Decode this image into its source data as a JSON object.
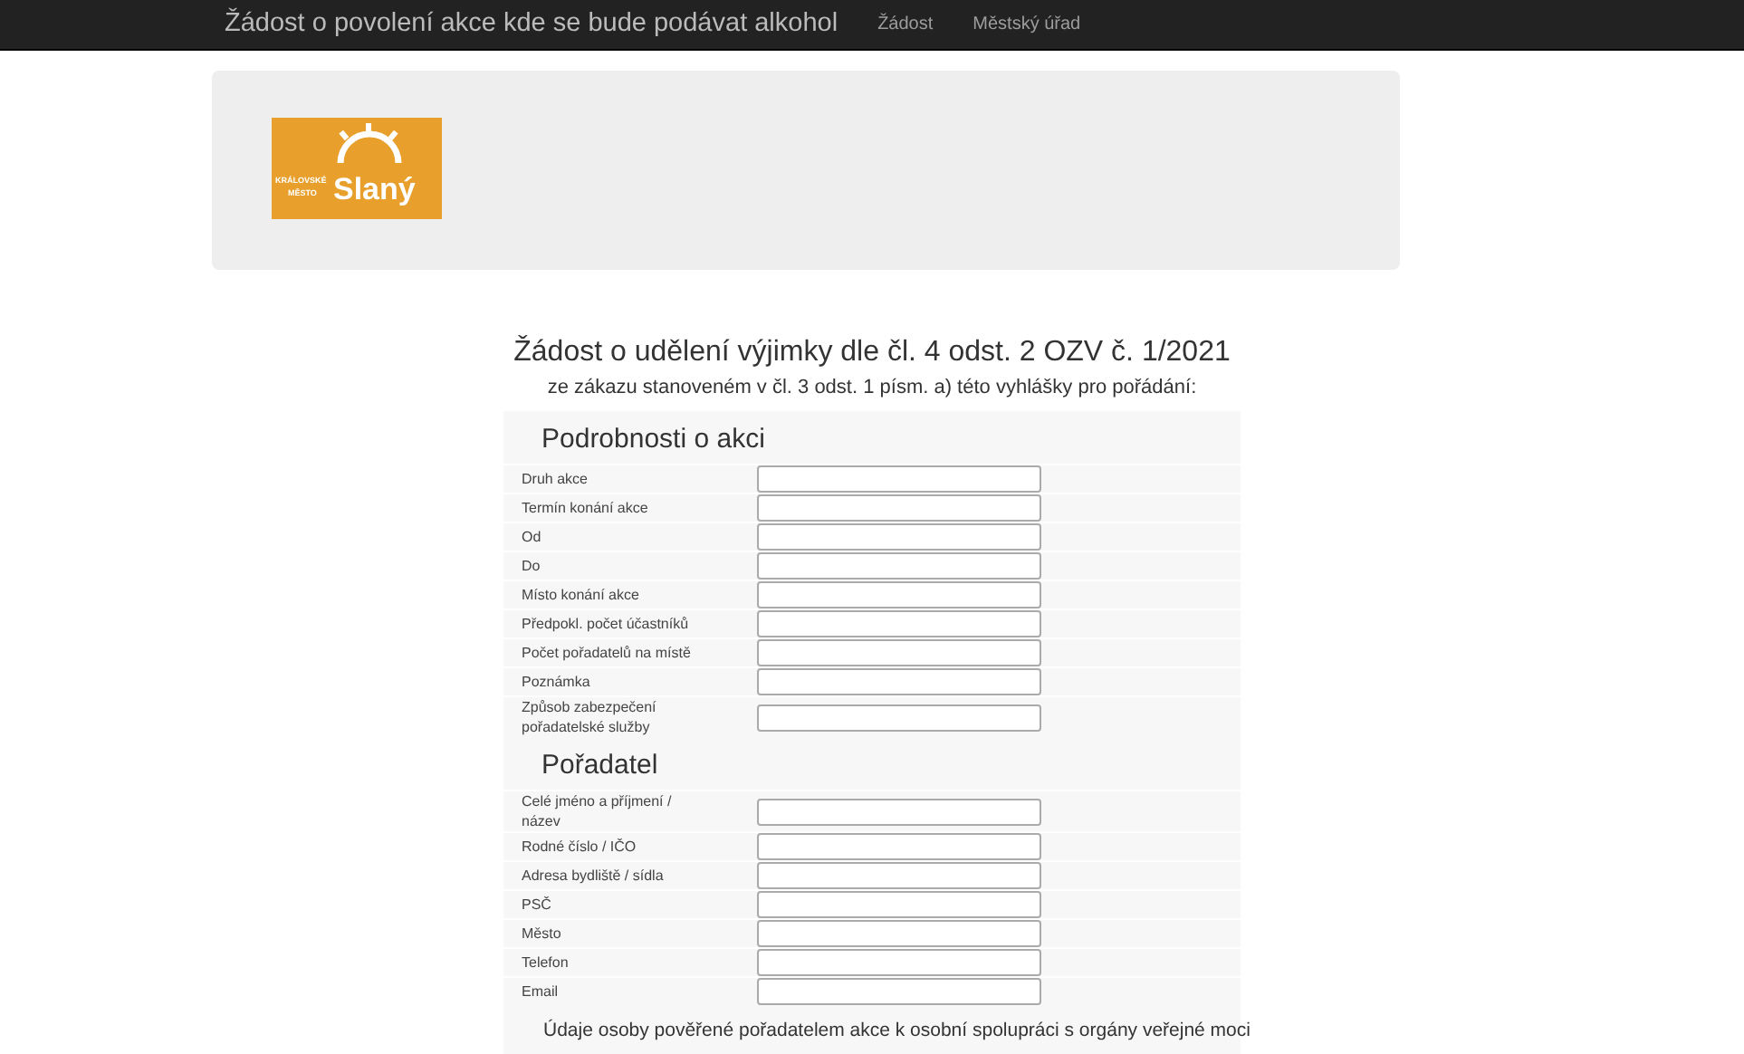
{
  "navbar": {
    "brand": "Žádost o povolení akce kde se bude podávat alkohol",
    "links": [
      "Žádost",
      "Městský úřad"
    ]
  },
  "logo": {
    "line_1": "KRÁLOVSKÉ",
    "line_2": "MĚSTO",
    "name": "Slaný"
  },
  "title": "Žádost o udělení výjimky dle čl. 4 odst. 2 OZV č. 1/2021",
  "subtitle": "ze zákazu stanoveném v čl. 3 odst. 1 písm. a) této vyhlášky pro pořádání:",
  "sections": [
    {
      "heading": "Podrobnosti o akci",
      "kind": "large",
      "fields": [
        "Druh akce",
        "Termín konání akce",
        "Od",
        "Do",
        "Místo konání akce",
        "Předpokl. počet účastníků",
        "Počet pořadatelů na místě",
        "Poznámka",
        "Způsob zabezpečení pořadatelské služby"
      ]
    },
    {
      "heading": "Pořadatel",
      "kind": "large",
      "fields": [
        "Celé jméno a příjmení / název",
        "Rodné číslo / IČO",
        "Adresa bydliště / sídla",
        "PSČ",
        "Město",
        "Telefon",
        "Email"
      ]
    },
    {
      "heading": "Údaje osoby pověřené pořadatelem akce k osobní spolupráci s orgány veřejné moci",
      "kind": "small"
    }
  ]
}
